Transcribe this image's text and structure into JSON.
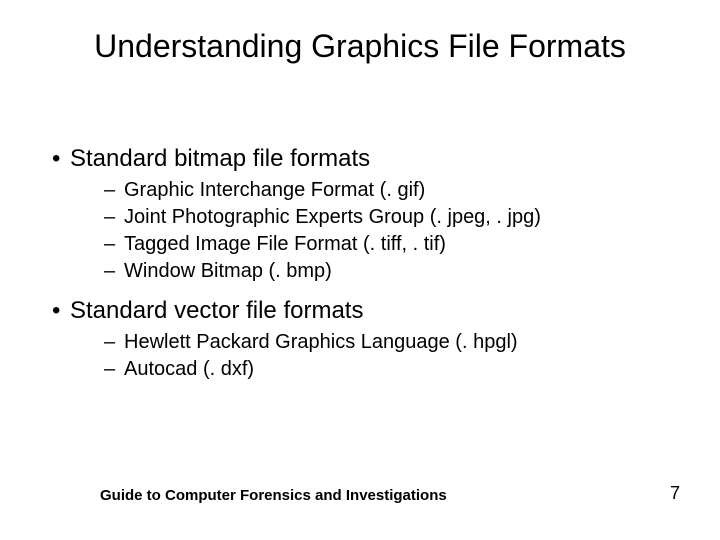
{
  "title": "Understanding Graphics File Formats",
  "sections": [
    {
      "heading": "Standard bitmap file formats",
      "items": [
        "Graphic Interchange Format (. gif)",
        "Joint Photographic Experts Group (. jpeg, . jpg)",
        "Tagged Image File Format (. tiff, . tif)",
        "Window Bitmap (. bmp)"
      ]
    },
    {
      "heading": "Standard vector file formats",
      "items": [
        "Hewlett Packard Graphics Language (. hpgl)",
        "Autocad (. dxf)"
      ]
    }
  ],
  "footer": "Guide to Computer Forensics and Investigations",
  "page_number": "7"
}
